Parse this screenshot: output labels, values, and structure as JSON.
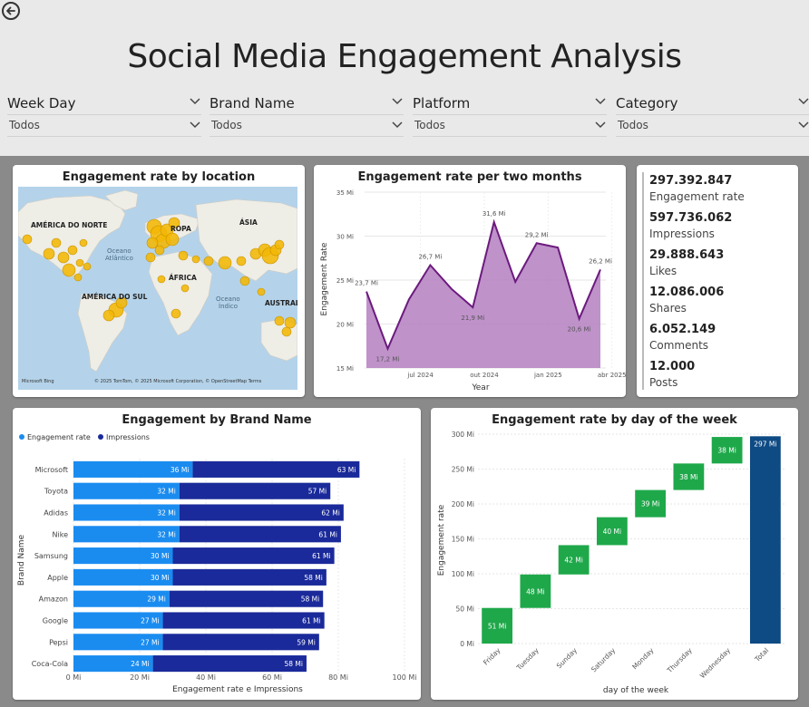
{
  "header": {
    "title": "Social Media Engagement Analysis",
    "slicers": [
      {
        "label": "Week Day",
        "value": "Todos"
      },
      {
        "label": "Brand Name",
        "value": "Todos"
      },
      {
        "label": "Platform",
        "value": "Todos"
      },
      {
        "label": "Category",
        "value": "Todos"
      }
    ]
  },
  "map": {
    "title": "Engagement rate by location",
    "labels": {
      "north_america": "AMÉRICA DO NORTE",
      "europe": "ROPA",
      "asia": "ÁSIA",
      "atlantic_1": "Oceano",
      "atlantic_2": "Atlântico",
      "africa": "ÁFRICA",
      "south_america": "AMÉRICA DO SUL",
      "indian_1": "Oceano",
      "indian_2": "Índico",
      "australia": "AUSTRAL"
    },
    "attribution": "© 2025 TomTom, © 2025 Microsoft Corporation, © OpenStreetMap  Terms",
    "logo": "Microsoft Bing",
    "bubble_color": "#f2b705"
  },
  "kpis": [
    {
      "value": "297.392.847",
      "label": "Engagement rate"
    },
    {
      "value": "597.736.062",
      "label": "Impressions"
    },
    {
      "value": "29.888.643",
      "label": "Likes"
    },
    {
      "value": "12.086.006",
      "label": "Shares"
    },
    {
      "value": "6.052.149",
      "label": "Comments"
    },
    {
      "value": "12.000",
      "label": "Posts"
    }
  ],
  "chart_data": [
    {
      "type": "area",
      "title": "Engagement rate per two months",
      "xlabel": "Year",
      "ylabel": "Engagement Rate",
      "ylim": [
        15,
        35
      ],
      "yticks": [
        "15 Mi",
        "20 Mi",
        "25 Mi",
        "30 Mi",
        "35 Mi"
      ],
      "xticks": [
        "jul 2024",
        "out 2024",
        "jan 2025",
        "abr 2025"
      ],
      "x": [
        "2024-04",
        "2024-05",
        "2024-06",
        "2024-07",
        "2024-08",
        "2024-09",
        "2024-10",
        "2024-11",
        "2024-12",
        "2025-01",
        "2025-02",
        "2025-03",
        "2025-04"
      ],
      "values": [
        23.7,
        17.2,
        22.8,
        26.7,
        24.0,
        21.9,
        31.6,
        24.8,
        29.2,
        28.7,
        20.6,
        26.2
      ],
      "point_labels": [
        "23,7 Mi",
        "17,2 Mi",
        "",
        "26,7 Mi",
        "",
        "21,9 Mi",
        "31,6 Mi",
        "",
        "29,2 Mi",
        "",
        "20,6 Mi",
        "26,2 Mi"
      ],
      "grid": true,
      "color": "#6b1a7d",
      "fill": "#b47fc1"
    },
    {
      "type": "bar",
      "title": "Engagement by Brand Name",
      "xlabel": "Engagement rate e Impressions",
      "ylabel": "Brand Name",
      "xlim": [
        0,
        100
      ],
      "xticks": [
        "0 Mi",
        "20 Mi",
        "40 Mi",
        "60 Mi",
        "80 Mi",
        "100 Mi"
      ],
      "categories": [
        "Microsoft",
        "Toyota",
        "Adidas",
        "Nike",
        "Samsung",
        "Apple",
        "Amazon",
        "Google",
        "Pepsi",
        "Coca-Cola"
      ],
      "series": [
        {
          "name": "Engagement rate",
          "values": [
            36,
            32,
            32,
            32,
            30,
            30,
            29,
            27,
            27,
            24
          ],
          "labels": [
            "36 Mi",
            "32 Mi",
            "32 Mi",
            "32 Mi",
            "30 Mi",
            "30 Mi",
            "29 Mi",
            "27 Mi",
            "27 Mi",
            "24 Mi"
          ],
          "color": "#1a8cf0"
        },
        {
          "name": "Impressions",
          "values": [
            63,
            57,
            62,
            61,
            61,
            58,
            58,
            61,
            59,
            58
          ],
          "labels": [
            "63 Mi",
            "57 Mi",
            "62 Mi",
            "61 Mi",
            "61 Mi",
            "58 Mi",
            "58 Mi",
            "61 Mi",
            "59 Mi",
            "58 Mi"
          ],
          "color": "#1a2a9a"
        }
      ],
      "stacked": true,
      "legend": "top-left",
      "grid": true
    },
    {
      "type": "bar",
      "subtype": "waterfall",
      "title": "Engagement rate by day of the week",
      "xlabel": "day of the week",
      "ylabel": "Engagement rate",
      "ylim": [
        0,
        300
      ],
      "yticks": [
        "0 Mi",
        "50 Mi",
        "100 Mi",
        "150 Mi",
        "200 Mi",
        "250 Mi",
        "300 Mi"
      ],
      "categories": [
        "Friday",
        "Tuesday",
        "Sunday",
        "Saturday",
        "Monday",
        "Thursday",
        "Wednesday",
        "Total"
      ],
      "values": [
        51,
        48,
        42,
        40,
        39,
        38,
        38,
        297
      ],
      "labels": [
        "51 Mi",
        "48 Mi",
        "42 Mi",
        "40 Mi",
        "39 Mi",
        "38 Mi",
        "38 Mi",
        "297 Mi"
      ],
      "increase_color": "#1fa84a",
      "total_color": "#0e4a84",
      "grid": true
    }
  ]
}
